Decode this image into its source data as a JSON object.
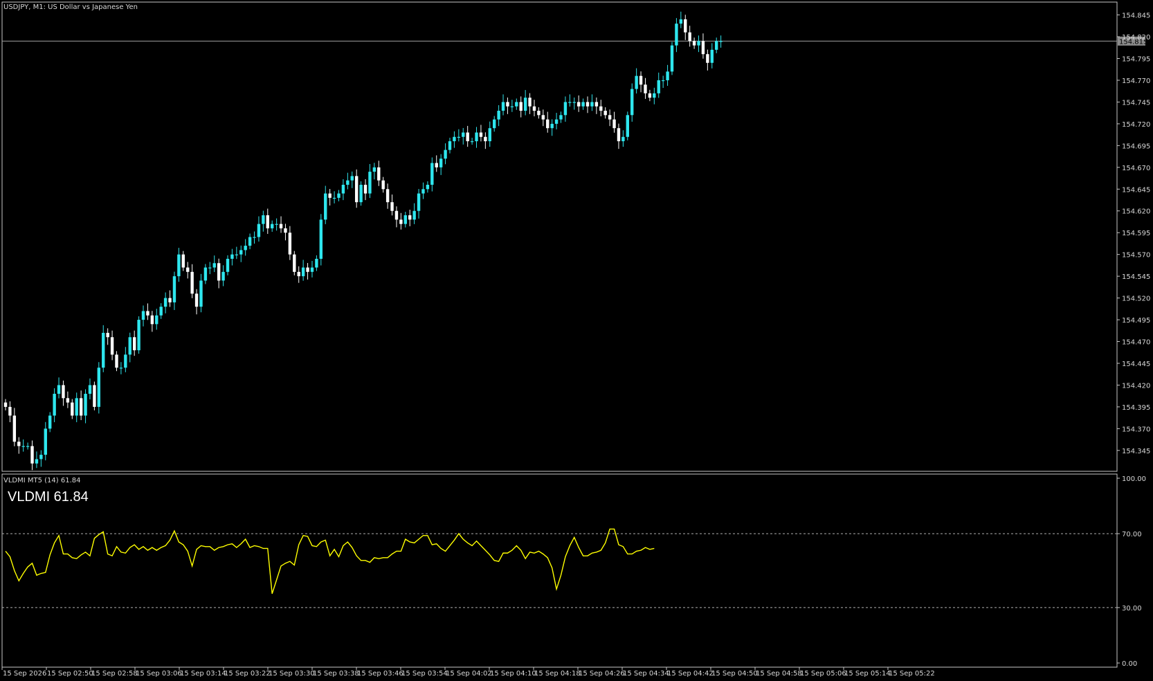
{
  "header": {
    "symbol_line": "USDJPY, M1:  US Dollar vs Japanese Yen"
  },
  "indicator": {
    "header_label": "VLDMI MT5 (14) 61.84",
    "big_label": "VLDMI 61.84"
  },
  "colors": {
    "background": "#000000",
    "bull_candle": "#2ee6ee",
    "bear_candle": "#ffffff",
    "indicator_line": "#ffff00",
    "frame": "#c8c8c8"
  },
  "chart_data": [
    {
      "type": "candlestick",
      "title": "USDJPY, M1:  US Dollar vs Japanese Yen",
      "ylim": [
        154.325,
        154.855
      ],
      "y_ticks": [
        154.845,
        154.82,
        154.795,
        154.77,
        154.745,
        154.72,
        154.695,
        154.67,
        154.645,
        154.62,
        154.595,
        154.57,
        154.545,
        154.52,
        154.495,
        154.47,
        154.445,
        154.42,
        154.395,
        154.37,
        154.345
      ],
      "y_tick_labels": [
        "154.845",
        "154.820",
        "154.795",
        "154.770",
        "154.745",
        "154.720",
        "154.695",
        "154.670",
        "154.645",
        "154.620",
        "154.595",
        "154.570",
        "154.545",
        "154.520",
        "154.495",
        "154.470",
        "154.445",
        "154.420",
        "154.395",
        "154.370",
        "154.345"
      ],
      "current_price": 154.815,
      "current_price_label": "154.815",
      "x_labels": [
        "15 Sep 2026",
        "15 Sep 02:50",
        "15 Sep 02:58",
        "15 Sep 03:06",
        "15 Sep 03:14",
        "15 Sep 03:22",
        "15 Sep 03:30",
        "15 Sep 03:38",
        "15 Sep 03:46",
        "15 Sep 03:54",
        "15 Sep 04:02",
        "15 Sep 04:10",
        "15 Sep 04:18",
        "15 Sep 04:26",
        "15 Sep 04:34",
        "15 Sep 04:42",
        "15 Sep 04:50",
        "15 Sep 04:58",
        "15 Sep 05:06",
        "15 Sep 05:14",
        "15 Sep 05:22"
      ],
      "close": [
        154.395,
        154.385,
        154.355,
        154.35,
        154.35,
        154.35,
        154.33,
        154.335,
        154.34,
        154.37,
        154.385,
        154.41,
        154.42,
        154.405,
        154.4,
        154.385,
        154.405,
        154.385,
        154.41,
        154.42,
        154.395,
        154.44,
        154.48,
        154.475,
        154.455,
        154.44,
        154.44,
        154.455,
        154.475,
        154.46,
        154.495,
        154.505,
        154.5,
        154.49,
        154.5,
        154.51,
        154.52,
        154.515,
        154.545,
        154.57,
        154.555,
        154.55,
        154.525,
        154.51,
        154.54,
        154.555,
        154.555,
        154.56,
        154.54,
        154.55,
        154.565,
        154.57,
        154.57,
        154.575,
        154.58,
        154.59,
        154.59,
        154.605,
        154.615,
        154.6,
        154.605,
        154.605,
        154.6,
        154.595,
        154.57,
        154.55,
        154.545,
        154.555,
        154.55,
        154.555,
        154.565,
        154.61,
        154.64,
        154.635,
        154.635,
        154.64,
        154.65,
        154.655,
        154.66,
        154.63,
        154.65,
        154.64,
        154.665,
        154.67,
        154.655,
        154.645,
        154.63,
        154.62,
        154.61,
        154.605,
        154.615,
        154.61,
        154.62,
        154.64,
        154.645,
        154.65,
        154.675,
        154.67,
        154.68,
        154.69,
        154.7,
        154.705,
        154.705,
        154.71,
        154.7,
        154.7,
        154.71,
        154.705,
        154.7,
        154.715,
        154.725,
        154.735,
        154.745,
        154.74,
        154.74,
        154.745,
        154.735,
        154.75,
        154.74,
        154.735,
        154.73,
        154.725,
        154.715,
        154.72,
        154.725,
        154.73,
        154.745,
        154.745,
        154.745,
        154.74,
        154.745,
        154.74,
        154.745,
        154.74,
        154.735,
        154.73,
        154.725,
        154.715,
        154.7,
        154.705,
        154.73,
        154.76,
        154.775,
        154.765,
        154.755,
        154.75,
        154.755,
        154.77,
        154.77,
        154.78,
        154.81,
        154.835,
        154.84,
        154.825,
        154.815,
        154.81,
        154.815,
        154.8,
        154.79,
        154.805,
        154.815,
        154.815
      ],
      "indicator": {
        "name": "VLDMI MT5 (14)",
        "value": 61.84,
        "ylim": [
          0,
          100
        ],
        "levels": [
          30,
          70
        ],
        "y_tick_labels": [
          "100.00",
          "70.00",
          "30.00",
          "0.00"
        ],
        "values": [
          60.5,
          57.5,
          50.0,
          44.5,
          48.5,
          52.0,
          54.0,
          47.5,
          48.5,
          49.0,
          58.5,
          65.0,
          69.0,
          59.0,
          59.0,
          57.0,
          56.5,
          58.5,
          60.0,
          58.0,
          67.5,
          69.5,
          71.0,
          59.0,
          58.0,
          63.0,
          60.0,
          59.5,
          62.5,
          64.0,
          61.5,
          63.0,
          61.0,
          62.5,
          61.0,
          62.5,
          63.5,
          66.5,
          71.5,
          65.5,
          64.0,
          60.5,
          52.5,
          61.5,
          63.5,
          63.0,
          63.0,
          61.0,
          62.5,
          63.0,
          64.0,
          64.5,
          62.5,
          64.5,
          67.0,
          62.5,
          63.5,
          63.0,
          62.0,
          62.0,
          37.5,
          45.0,
          52.5,
          54.0,
          55.0,
          53.0,
          64.0,
          69.0,
          68.5,
          63.5,
          63.0,
          65.5,
          66.5,
          58.0,
          61.5,
          57.5,
          63.5,
          65.5,
          62.5,
          58.0,
          55.5,
          55.5,
          54.5,
          57.0,
          56.5,
          57.0,
          57.0,
          59.0,
          60.5,
          60.5,
          67.0,
          65.5,
          65.0,
          67.0,
          69.0,
          69.0,
          64.0,
          64.5,
          62.0,
          60.5,
          63.5,
          66.5,
          70.0,
          67.0,
          65.0,
          63.5,
          66.0,
          63.5,
          61.0,
          58.5,
          55.5,
          55.0,
          59.5,
          59.5,
          61.0,
          63.5,
          61.0,
          56.5,
          60.0,
          59.5,
          60.5,
          59.0,
          57.0,
          51.5,
          40.0,
          47.5,
          57.5,
          63.5,
          68.0,
          62.5,
          58.0,
          58.0,
          59.5,
          60.0,
          61.0,
          65.0,
          72.5,
          72.5,
          64.0,
          63.0,
          59.0,
          59.0,
          60.5,
          61.0,
          62.5,
          61.5,
          62.0
        ]
      }
    }
  ]
}
